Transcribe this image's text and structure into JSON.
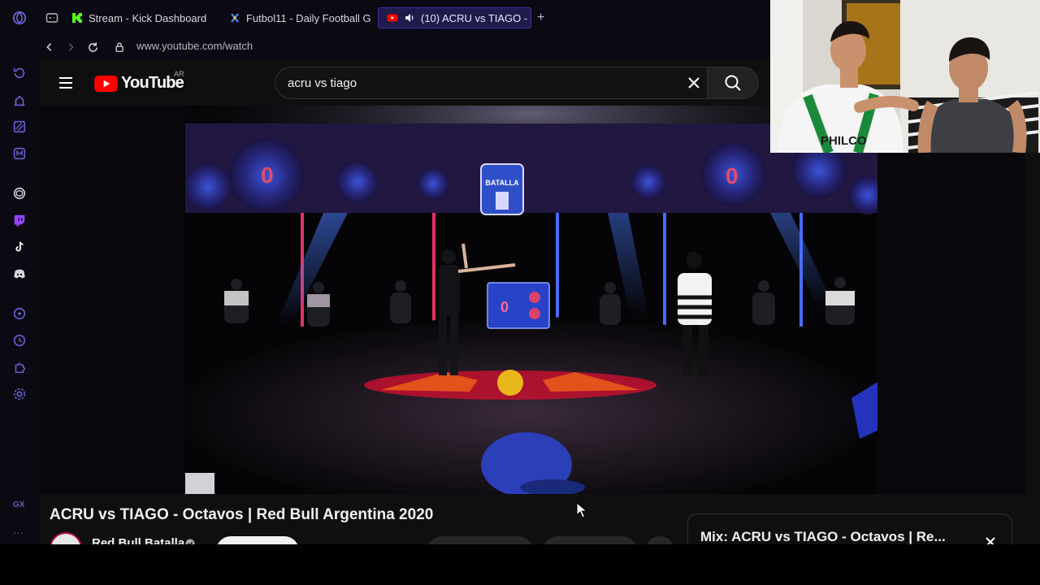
{
  "browser": {
    "tabs": [
      {
        "label": "Stream - Kick Dashboard",
        "icon": "kick-icon"
      },
      {
        "label": "Futbol11 - Daily Football G",
        "icon": "futbol11-icon"
      },
      {
        "label": "(10) ACRU vs TIAGO - ",
        "icon": "youtube-icon",
        "active": true
      }
    ],
    "new_tab_label": "+",
    "url": "www.youtube.com/watch",
    "gx_label": "GX",
    "more_label": "···",
    "accent_color": "#3b33a8"
  },
  "youtube": {
    "logo_text": "YouTube",
    "region": "AR",
    "search_query": "acru vs tiago",
    "video_title": "ACRU vs TIAGO - Octavos | Red Bull Argentina 2020",
    "channel_name": "Red Bull Batalla",
    "mix_title": "Mix: ACRU vs TIAGO - Octavos | Re..."
  },
  "video": {
    "stage_sign": "BATALLA",
    "screen_numbers": [
      "0",
      "0",
      "0"
    ],
    "jersey_text": "PHILCO"
  }
}
